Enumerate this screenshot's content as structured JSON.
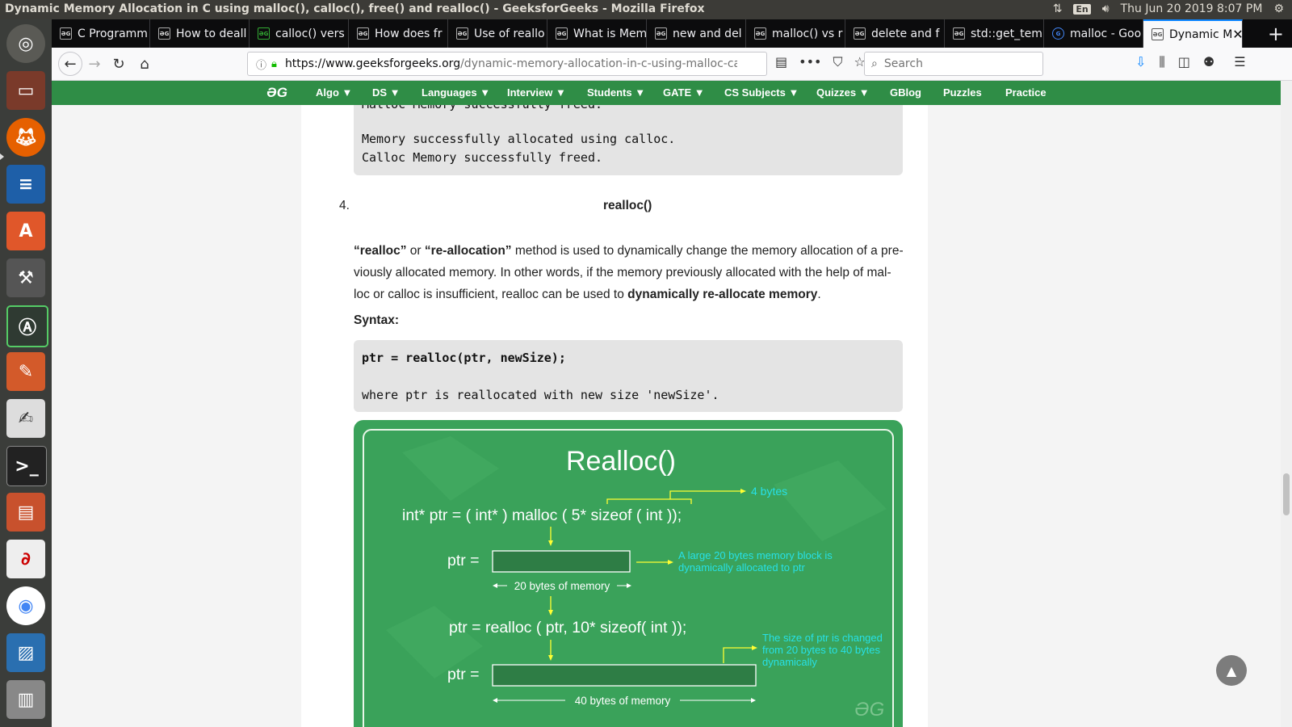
{
  "system": {
    "window_title": "Dynamic Memory Allocation in C using malloc(), calloc(), free() and realloc() - GeeksforGeeks - Mozilla Firefox",
    "lang": "En",
    "datetime": "Thu Jun 20 2019  8:07 PM"
  },
  "tabs": [
    {
      "label": "C Programm"
    },
    {
      "label": "How to deall"
    },
    {
      "label": "calloc() vers"
    },
    {
      "label": "How does fr"
    },
    {
      "label": "Use of reallo"
    },
    {
      "label": "What is Mem"
    },
    {
      "label": "new and del"
    },
    {
      "label": "malloc() vs r"
    },
    {
      "label": "delete and f"
    },
    {
      "label": "std::get_tem"
    },
    {
      "label": "malloc - Goo"
    },
    {
      "label": "Dynamic M"
    }
  ],
  "urlbar": {
    "domain": "https://www.geeksforgeeks.org",
    "path": "/dynamic-memory-allocation-in-c-using-malloc-calloc-free-and-realloc/"
  },
  "search": {
    "placeholder": "Search"
  },
  "gfgnav": {
    "logo": "ƏG",
    "items": [
      "Algo ▼",
      "DS ▼",
      "Languages ▼",
      "Interview ▼",
      "Students ▼",
      "GATE ▼",
      "CS Subjects ▼",
      "Quizzes ▼",
      "GBlog",
      "Puzzles",
      "Practice"
    ]
  },
  "article": {
    "prev_code": [
      "Malloc Memory successfully freed.",
      "Memory successfully allocated using calloc.",
      "Calloc Memory successfully freed."
    ],
    "item_number": "4.",
    "item_title": "realloc()",
    "para": {
      "q1": "“realloc”",
      "or": " or ",
      "q2": "“re-allocation”",
      "line1_rest": " method is used to dynamically change the memory allocation of a pre-",
      "line2": "viously allocated memory. In other words, if the memory previously allocated with the help of mal-",
      "line3_a": "loc or calloc is insufficient, realloc can be used to ",
      "line3_b": "dynamically re-allocate memory",
      "line3_c": "."
    },
    "syntax_label": "Syntax:",
    "syntax_code": "ptr = realloc(ptr, newSize);",
    "syntax_note": "where ptr is reallocated with new size 'newSize'."
  },
  "diagram": {
    "title": "Realloc()",
    "line1": "int* ptr = ( int* ) malloc ( 5* sizeof ( int ));",
    "four_bytes": "4 bytes",
    "ptr_label1": "ptr =",
    "note1_a": "A large 20 bytes memory block is",
    "note1_b": "dynamically allocated to ptr",
    "mem20": "20 bytes of memory",
    "line2": "ptr = realloc ( ptr, 10* sizeof( int ));",
    "ptr_label2": "ptr =",
    "note2_a": "The size of ptr is changed",
    "note2_b": "from 20 bytes to 40 bytes",
    "note2_c": "dynamically",
    "mem40": "40 bytes of memory",
    "watermark": "ƏG",
    "colors": {
      "bg": "#3da35d",
      "frame": "#2e8b46",
      "accent": "#ffff33",
      "note": "#27e0e6"
    }
  }
}
